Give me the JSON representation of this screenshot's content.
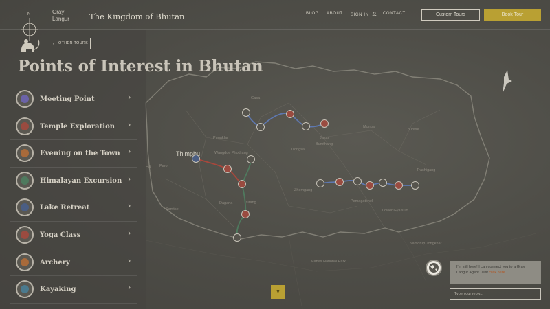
{
  "header": {
    "brand_line1": "Gray",
    "brand_line2": "Langur",
    "site_title": "The Kingdom of Bhutan",
    "nav": [
      "BLOG",
      "ABOUT",
      "SIGN IN",
      "CONTACT"
    ],
    "custom_tours": "Custom Tours",
    "book_tour": "Book Tour"
  },
  "panel": {
    "other_tours": "OTHER TOURS",
    "title": "Points of Interest in Bhutan",
    "items": [
      {
        "label": "Meeting Point",
        "icon": "meeting-point-icon",
        "color": "#6b63a8"
      },
      {
        "label": "Temple Exploration",
        "icon": "temple-icon",
        "color": "#9a4b40"
      },
      {
        "label": "Evening on the Town",
        "icon": "evening-icon",
        "color": "#a86a3a"
      },
      {
        "label": "Himalayan Excursion",
        "icon": "mountain-icon",
        "color": "#4f7a5e"
      },
      {
        "label": "Lake Retreat",
        "icon": "lake-icon",
        "color": "#4b5e83"
      },
      {
        "label": "Yoga Class",
        "icon": "yoga-icon",
        "color": "#9a4b40"
      },
      {
        "label": "Archery",
        "icon": "archery-icon",
        "color": "#a86a3a"
      },
      {
        "label": "Kayaking",
        "icon": "kayak-icon",
        "color": "#4b7a8e"
      }
    ]
  },
  "map": {
    "city": "Thimphu",
    "places": [
      "Punakha",
      "Wangdue Phodrang",
      "Paro",
      "Bumthang",
      "Mongar",
      "Trashigang",
      "Lhuntse",
      "Trongsa",
      "Zhemgang",
      "Tsirang",
      "Dagana",
      "Samtse",
      "Samdrup Jongkhar",
      "Pemagatshel",
      "Lower Gyalsum",
      "Manas National Park",
      "Ha",
      "Gasa",
      "Jakar"
    ]
  },
  "chat": {
    "message": "I'm still here! I can connect you to a Gray Langur Agent. Just ",
    "link": "click here.",
    "placeholder": "Type your reply..."
  }
}
